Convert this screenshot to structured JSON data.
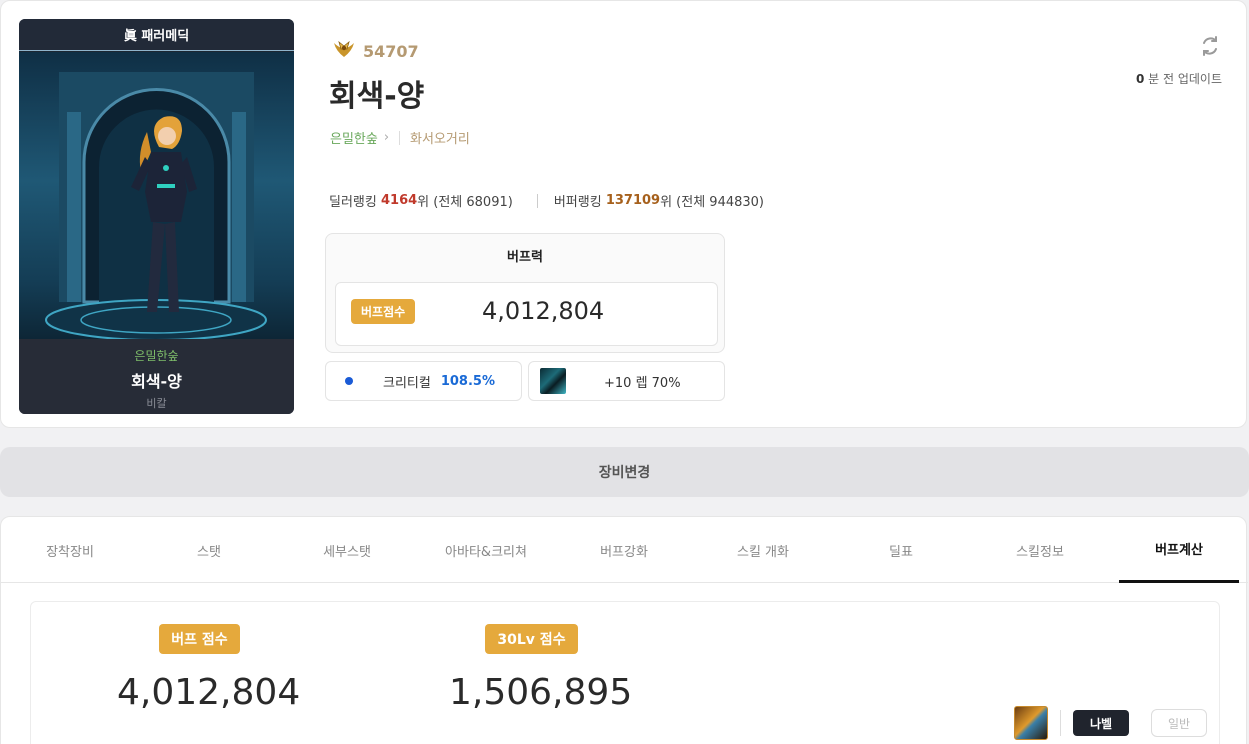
{
  "character_panel": {
    "title": "眞 패러메딕",
    "server": "은밀한숲",
    "name": "회색-양",
    "class": "비칼"
  },
  "profile": {
    "fame_icon": "gold-laurel-emblem-icon",
    "fame_value": "54707",
    "name": "회색-양",
    "server": "은밀한숲",
    "guild": "화서오거리"
  },
  "update": {
    "refresh_icon": "refresh-icon",
    "minutes": "0",
    "suffix": "분 전 업데이트"
  },
  "ranking": {
    "dealer_label": "딜러랭킹",
    "dealer_rank": "4164",
    "dealer_suffix": "위 (전체 68091)",
    "buffer_label": "버퍼랭킹",
    "buffer_rank": "137109",
    "buffer_suffix": "위 (전체 944830)"
  },
  "buff_power": {
    "title": "버프력",
    "badge": "버프점수",
    "value": "4,012,804"
  },
  "critical": {
    "label": "크리티컬",
    "value": "108.5%"
  },
  "skill_level": {
    "icon": "skill-thumbnail-icon",
    "text": "+10 렙 70%"
  },
  "equip_change": {
    "label": "장비변경"
  },
  "tabs": [
    {
      "label": "장착장비",
      "active": false
    },
    {
      "label": "스탯",
      "active": false
    },
    {
      "label": "세부스탯",
      "active": false
    },
    {
      "label": "아바타&크리쳐",
      "active": false
    },
    {
      "label": "버프강화",
      "active": false
    },
    {
      "label": "스킬 개화",
      "active": false
    },
    {
      "label": "딜표",
      "active": false
    },
    {
      "label": "스킬정보",
      "active": false
    },
    {
      "label": "버프계산",
      "active": true
    }
  ],
  "calc": {
    "buff_score_label": "버프 점수",
    "buff_score_value": "4,012,804",
    "lv30_score_label": "30Lv 점수",
    "lv30_score_value": "1,506,895"
  },
  "mode": {
    "thumb_icon": "weapon-thumbnail-icon",
    "active_label": "나벨",
    "inactive_label": "일반"
  },
  "colors": {
    "accent_gold": "#e5a93c",
    "dealer_rank": "#c0392b",
    "buffer_rank": "#a6601c",
    "critical": "#1a6ad6",
    "server_green": "#6aa85c"
  }
}
